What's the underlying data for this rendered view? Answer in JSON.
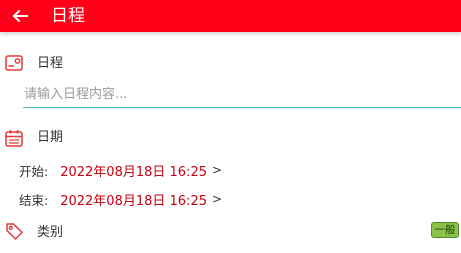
{
  "colors": {
    "appbar": "#ff0018",
    "accent_red": "#c8000f",
    "input_underline": "#4fc3b8",
    "badge_bg": "#8bc34a"
  },
  "header": {
    "back_icon": "arrow-left-icon",
    "title": "日程"
  },
  "schedule_section": {
    "icon": "card-icon",
    "label": "日程",
    "input_value": "",
    "input_placeholder": "请输入日程内容..."
  },
  "date_section": {
    "icon": "calendar-icon",
    "label": "日期",
    "start_label": "开始:",
    "start_value": "2022年08月18日 16:25",
    "end_label": "结束:",
    "end_value": "2022年08月18日 16:25",
    "arrow": ">"
  },
  "category_section": {
    "icon": "tag-icon",
    "label": "类别",
    "value": "一般"
  }
}
